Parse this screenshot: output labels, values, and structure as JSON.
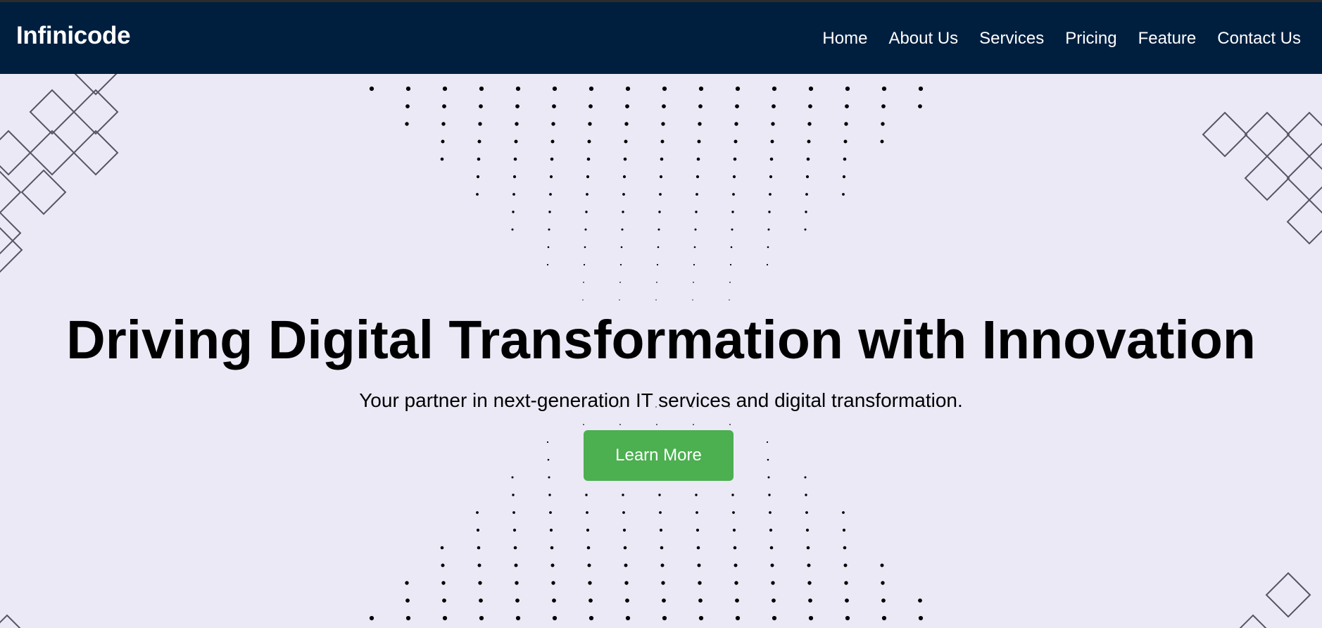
{
  "navbar": {
    "brand": "Infinicode",
    "background": "#001f3f",
    "links": [
      {
        "label": "Home"
      },
      {
        "label": "About Us"
      },
      {
        "label": "Services"
      },
      {
        "label": "Pricing"
      },
      {
        "label": "Feature"
      },
      {
        "label": "Contact Us"
      }
    ]
  },
  "hero": {
    "title": "Driving Digital Transformation with Innovation",
    "subtitle": "Your partner in next-generation IT services and digital transformation.",
    "cta_label": "Learn More",
    "cta_color": "#4caf50",
    "background": "#ece9f6"
  },
  "decorations": {
    "pattern_icon": "diamond-grid-pattern",
    "dots_icon": "halftone-dot-pattern"
  }
}
